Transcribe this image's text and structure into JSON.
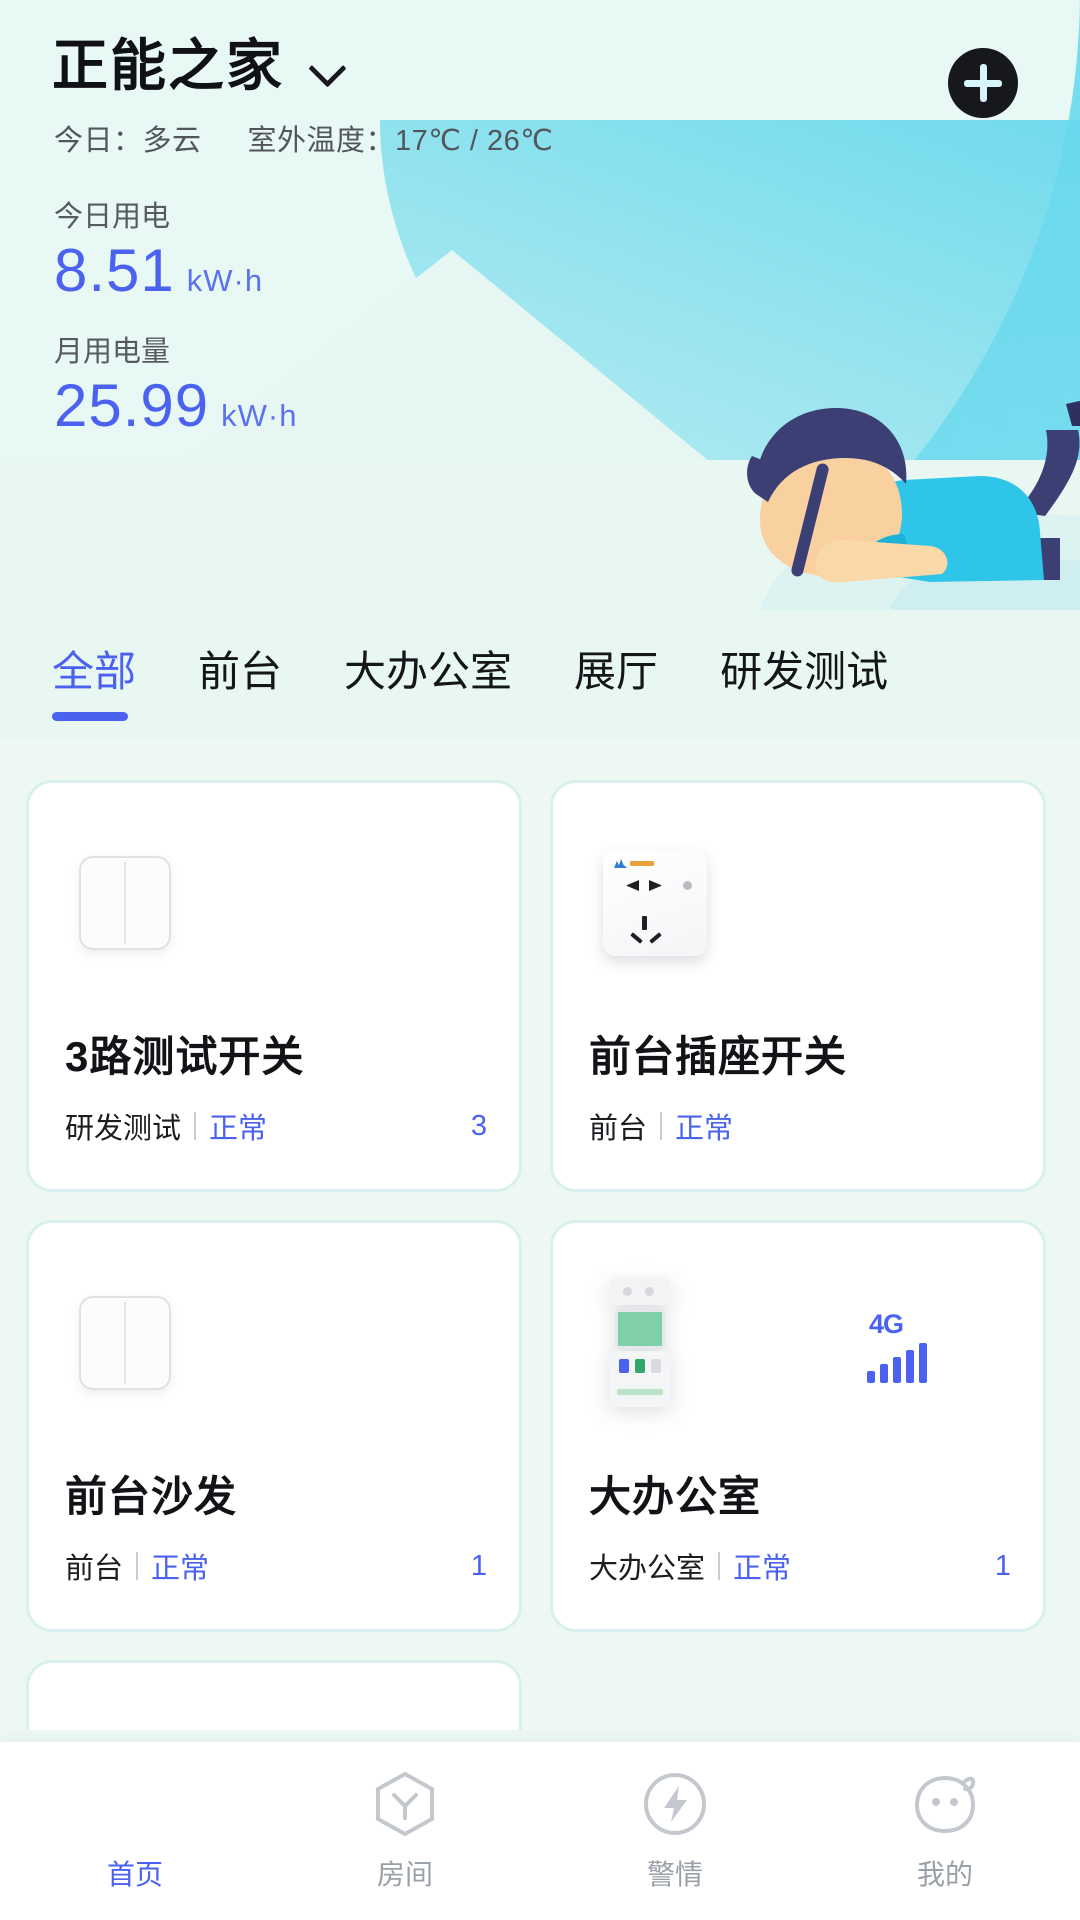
{
  "header": {
    "home_name": "正能之家",
    "dropdown_icon": "chevron-down-icon",
    "add_icon": "plus-icon",
    "weather_today": "今日：多云",
    "weather_temp": "室外温度：17℃ / 26℃",
    "today_usage_label": "今日用电",
    "today_usage_value": "8.51",
    "today_usage_unit": "kW·h",
    "month_usage_label": "月用电量",
    "month_usage_value": "25.99",
    "month_usage_unit": "kW·h",
    "accent_blue": "#4a62ef",
    "header_gradient_start": "#8fe3ec",
    "header_gradient_end": "#62d6ee"
  },
  "tabs": {
    "active_index": 0,
    "items": [
      {
        "label": "全部"
      },
      {
        "label": "前台"
      },
      {
        "label": "大办公室"
      },
      {
        "label": "展厅"
      },
      {
        "label": "研发测试"
      }
    ]
  },
  "devices": [
    {
      "name": "3路测试开关",
      "room": "研发测试",
      "status": "正常",
      "count": "3",
      "icon": "wall-switch-icon"
    },
    {
      "name": "前台插座开关",
      "room": "前台",
      "status": "正常",
      "count": "",
      "icon": "wall-socket-icon"
    },
    {
      "name": "前台沙发",
      "room": "前台",
      "status": "正常",
      "count": "1",
      "icon": "wall-switch-icon"
    },
    {
      "name": "大办公室",
      "room": "大办公室",
      "status": "正常",
      "count": "1",
      "icon": "smart-meter-icon",
      "signal_label": "4G"
    }
  ],
  "bottom_nav": {
    "active_index": 0,
    "items": [
      {
        "label": "首页",
        "icon": "home-icon"
      },
      {
        "label": "房间",
        "icon": "room-hex-icon"
      },
      {
        "label": "警情",
        "icon": "alarm-bolt-icon"
      },
      {
        "label": "我的",
        "icon": "profile-icon"
      }
    ]
  }
}
